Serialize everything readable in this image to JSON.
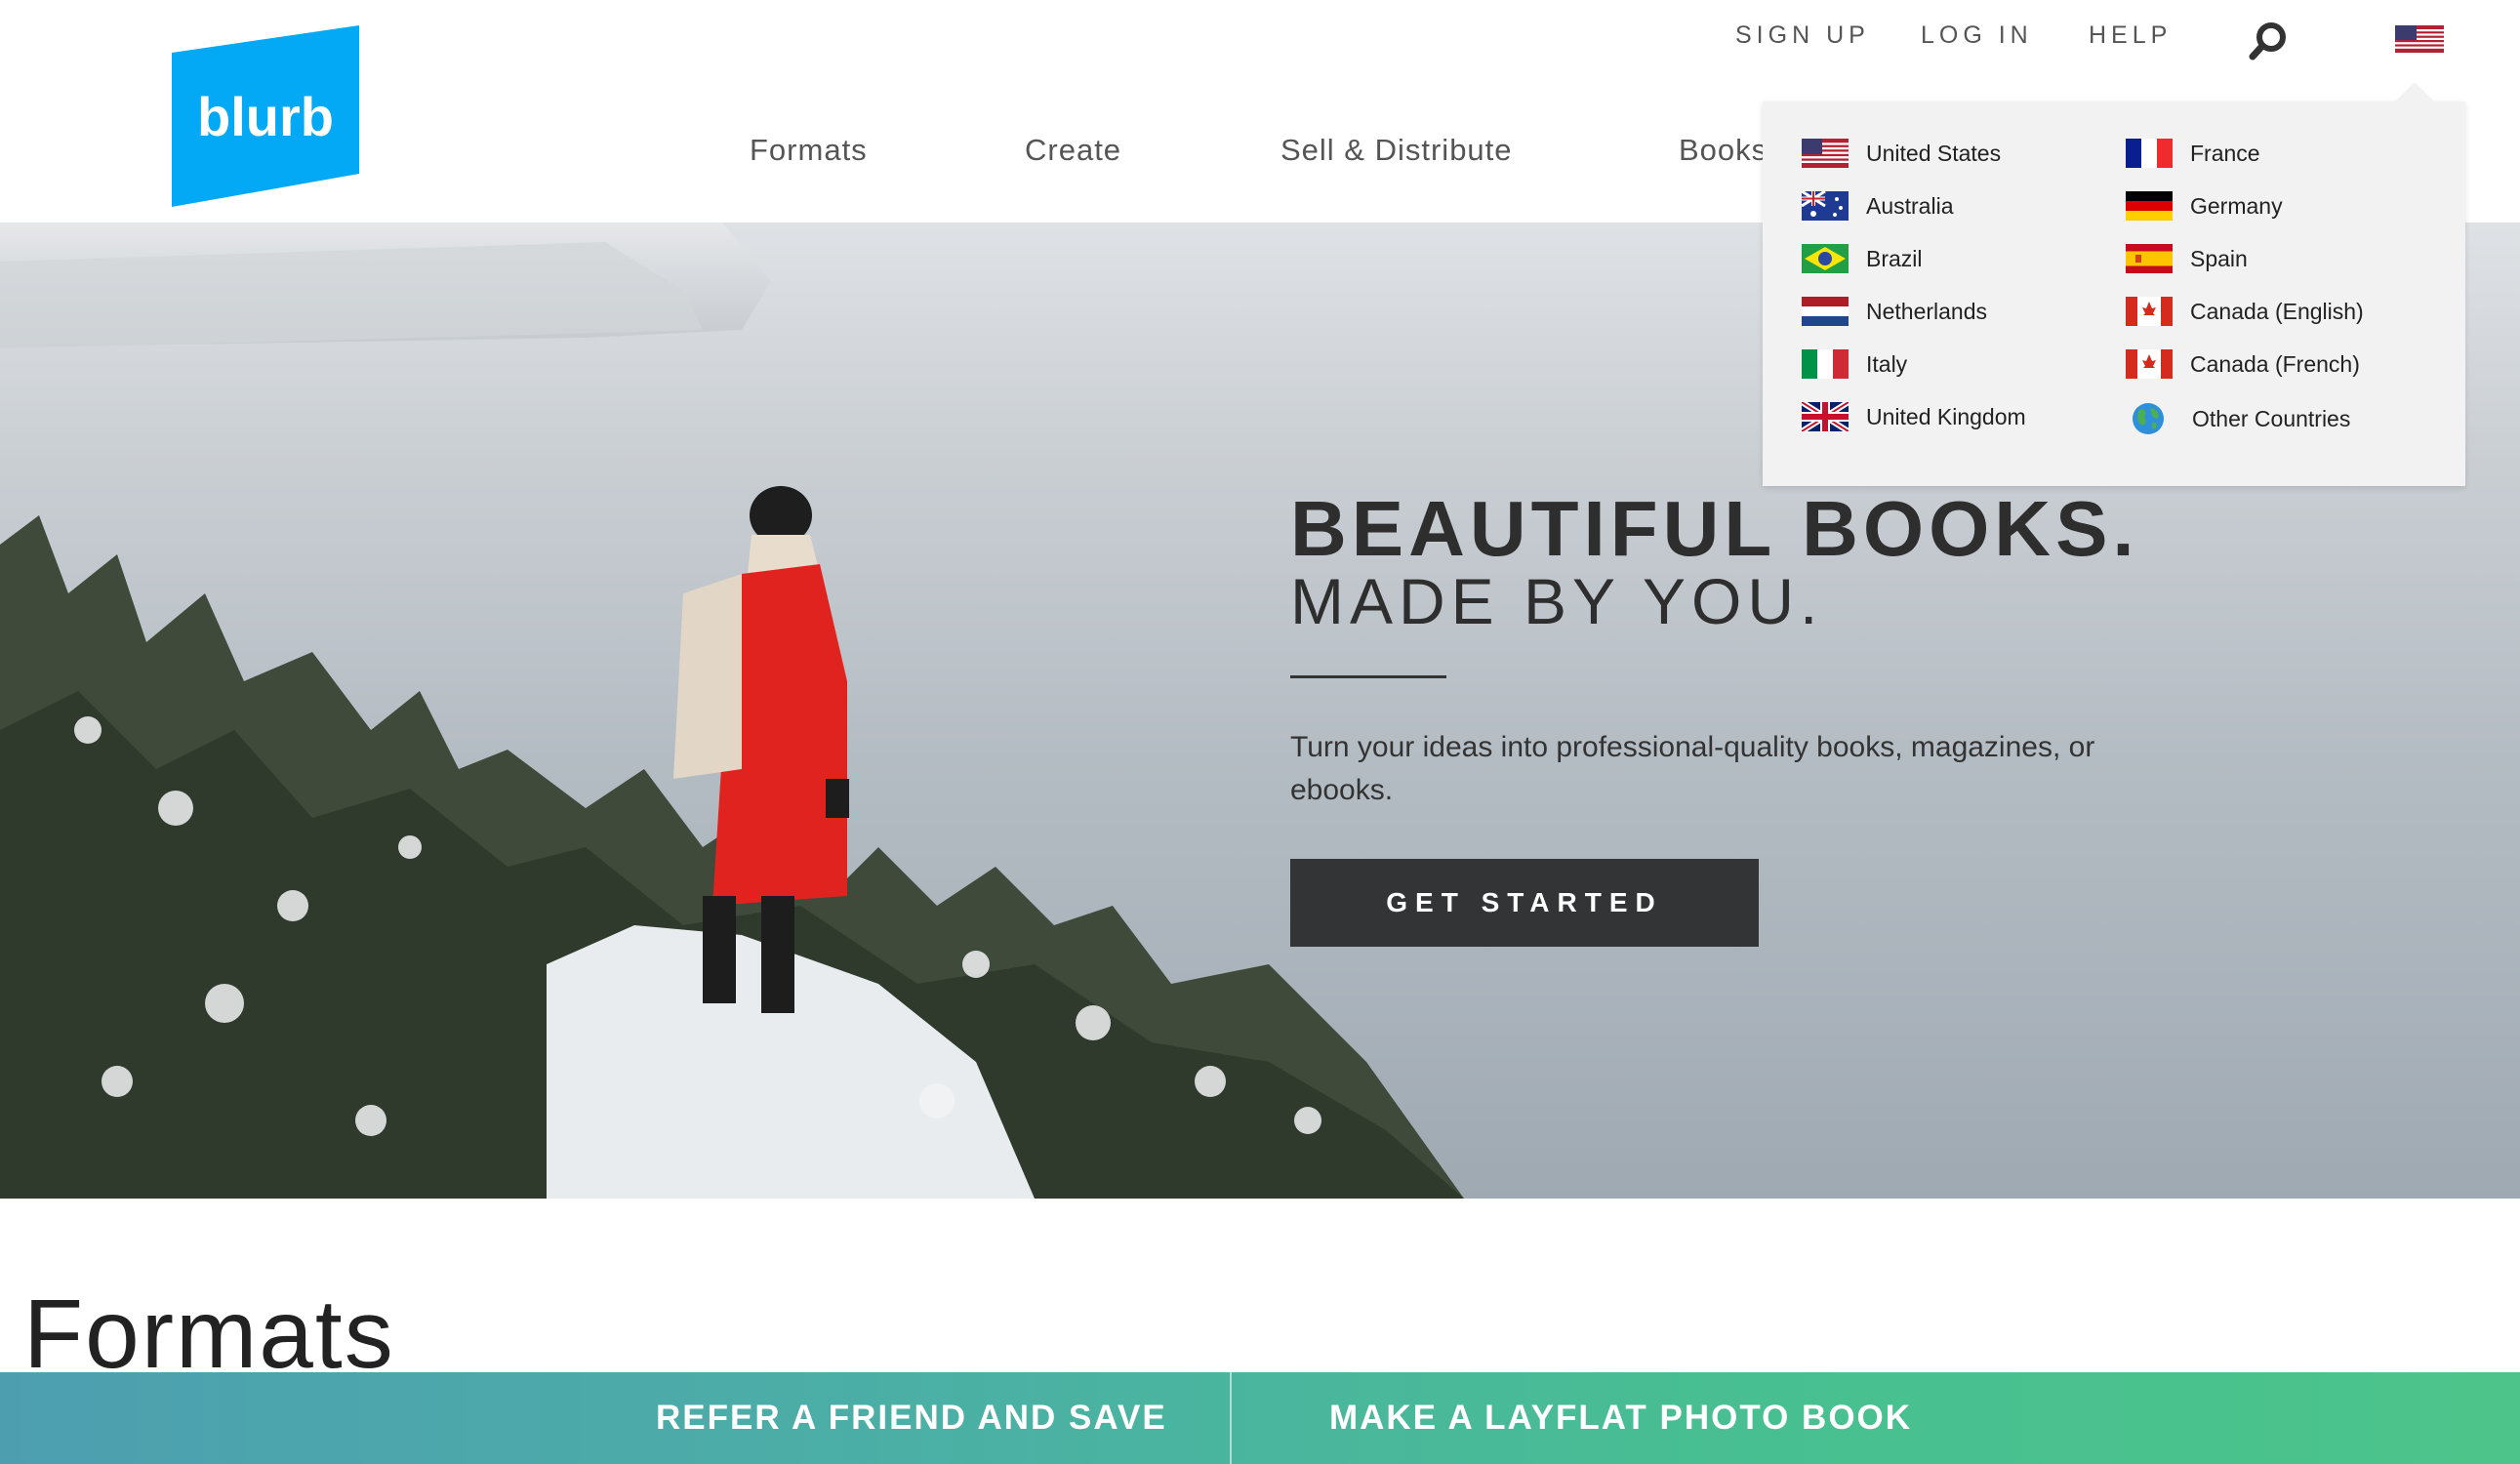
{
  "brand": {
    "logo_text": "blurb",
    "color": "#03A9F4"
  },
  "utility_nav": {
    "sign_up": "SIGN UP",
    "log_in": "LOG IN",
    "help": "HELP"
  },
  "icons": {
    "search": "search-icon",
    "flag": "us-flag-icon",
    "globe": "globe-icon"
  },
  "main_nav": {
    "formats": "Formats",
    "create": "Create",
    "sell": "Sell & Distribute",
    "books": "Books"
  },
  "country_menu": {
    "left": [
      {
        "label": "United States",
        "flag": "us"
      },
      {
        "label": "Australia",
        "flag": "au"
      },
      {
        "label": "Brazil",
        "flag": "br"
      },
      {
        "label": "Netherlands",
        "flag": "nl"
      },
      {
        "label": "Italy",
        "flag": "it"
      },
      {
        "label": "United Kingdom",
        "flag": "uk"
      }
    ],
    "right": [
      {
        "label": "France",
        "flag": "fr"
      },
      {
        "label": "Germany",
        "flag": "de"
      },
      {
        "label": "Spain",
        "flag": "es"
      },
      {
        "label": "Canada (English)",
        "flag": "ca"
      },
      {
        "label": "Canada (French)",
        "flag": "ca"
      },
      {
        "label": "Other Countries",
        "flag": "globe"
      }
    ]
  },
  "hero": {
    "title": "BEAUTIFUL BOOKS.",
    "subtitle": "MADE BY YOU.",
    "description": "Turn your ideas into professional-quality books, magazines, or ebooks.",
    "cta": "GET STARTED"
  },
  "formats_section": {
    "heading": "Formats"
  },
  "promo": {
    "left": "REFER A FRIEND AND SAVE",
    "right": "MAKE A LAYFLAT PHOTO BOOK",
    "gradient_start": "#4d9fb0",
    "gradient_end": "#4cc48a"
  }
}
